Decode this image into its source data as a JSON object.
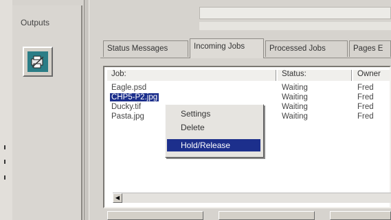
{
  "outputs": {
    "title": "Outputs",
    "icon": "printer-output-icon"
  },
  "tabs": [
    {
      "label": "Status Messages",
      "active": false
    },
    {
      "label": "Incoming Jobs",
      "active": true
    },
    {
      "label": "Processed Jobs",
      "active": false
    },
    {
      "label": "Pages E",
      "active": false
    }
  ],
  "columns": {
    "job": "Job:",
    "status": "Status:",
    "owner": "Owner"
  },
  "rows": [
    {
      "job": "Eagle.psd",
      "status": "Waiting",
      "owner": "Fred",
      "selected": false
    },
    {
      "job": "CHP5-P2.jpg",
      "status": "Waiting",
      "owner": "Fred",
      "selected": true
    },
    {
      "job": "Ducky.tif",
      "status": "Waiting",
      "owner": "Fred",
      "selected": false
    },
    {
      "job": "Pasta.jpg",
      "status": "Waiting",
      "owner": "Fred",
      "selected": false
    }
  ],
  "context_menu": {
    "items": [
      {
        "label": "Settings",
        "highlighted": false
      },
      {
        "label": "Delete",
        "highlighted": false
      },
      {
        "label": "Hold/Release",
        "highlighted": true
      }
    ]
  },
  "colors": {
    "selection": "#1c2f8c",
    "icon_bg": "#2b7d86"
  }
}
